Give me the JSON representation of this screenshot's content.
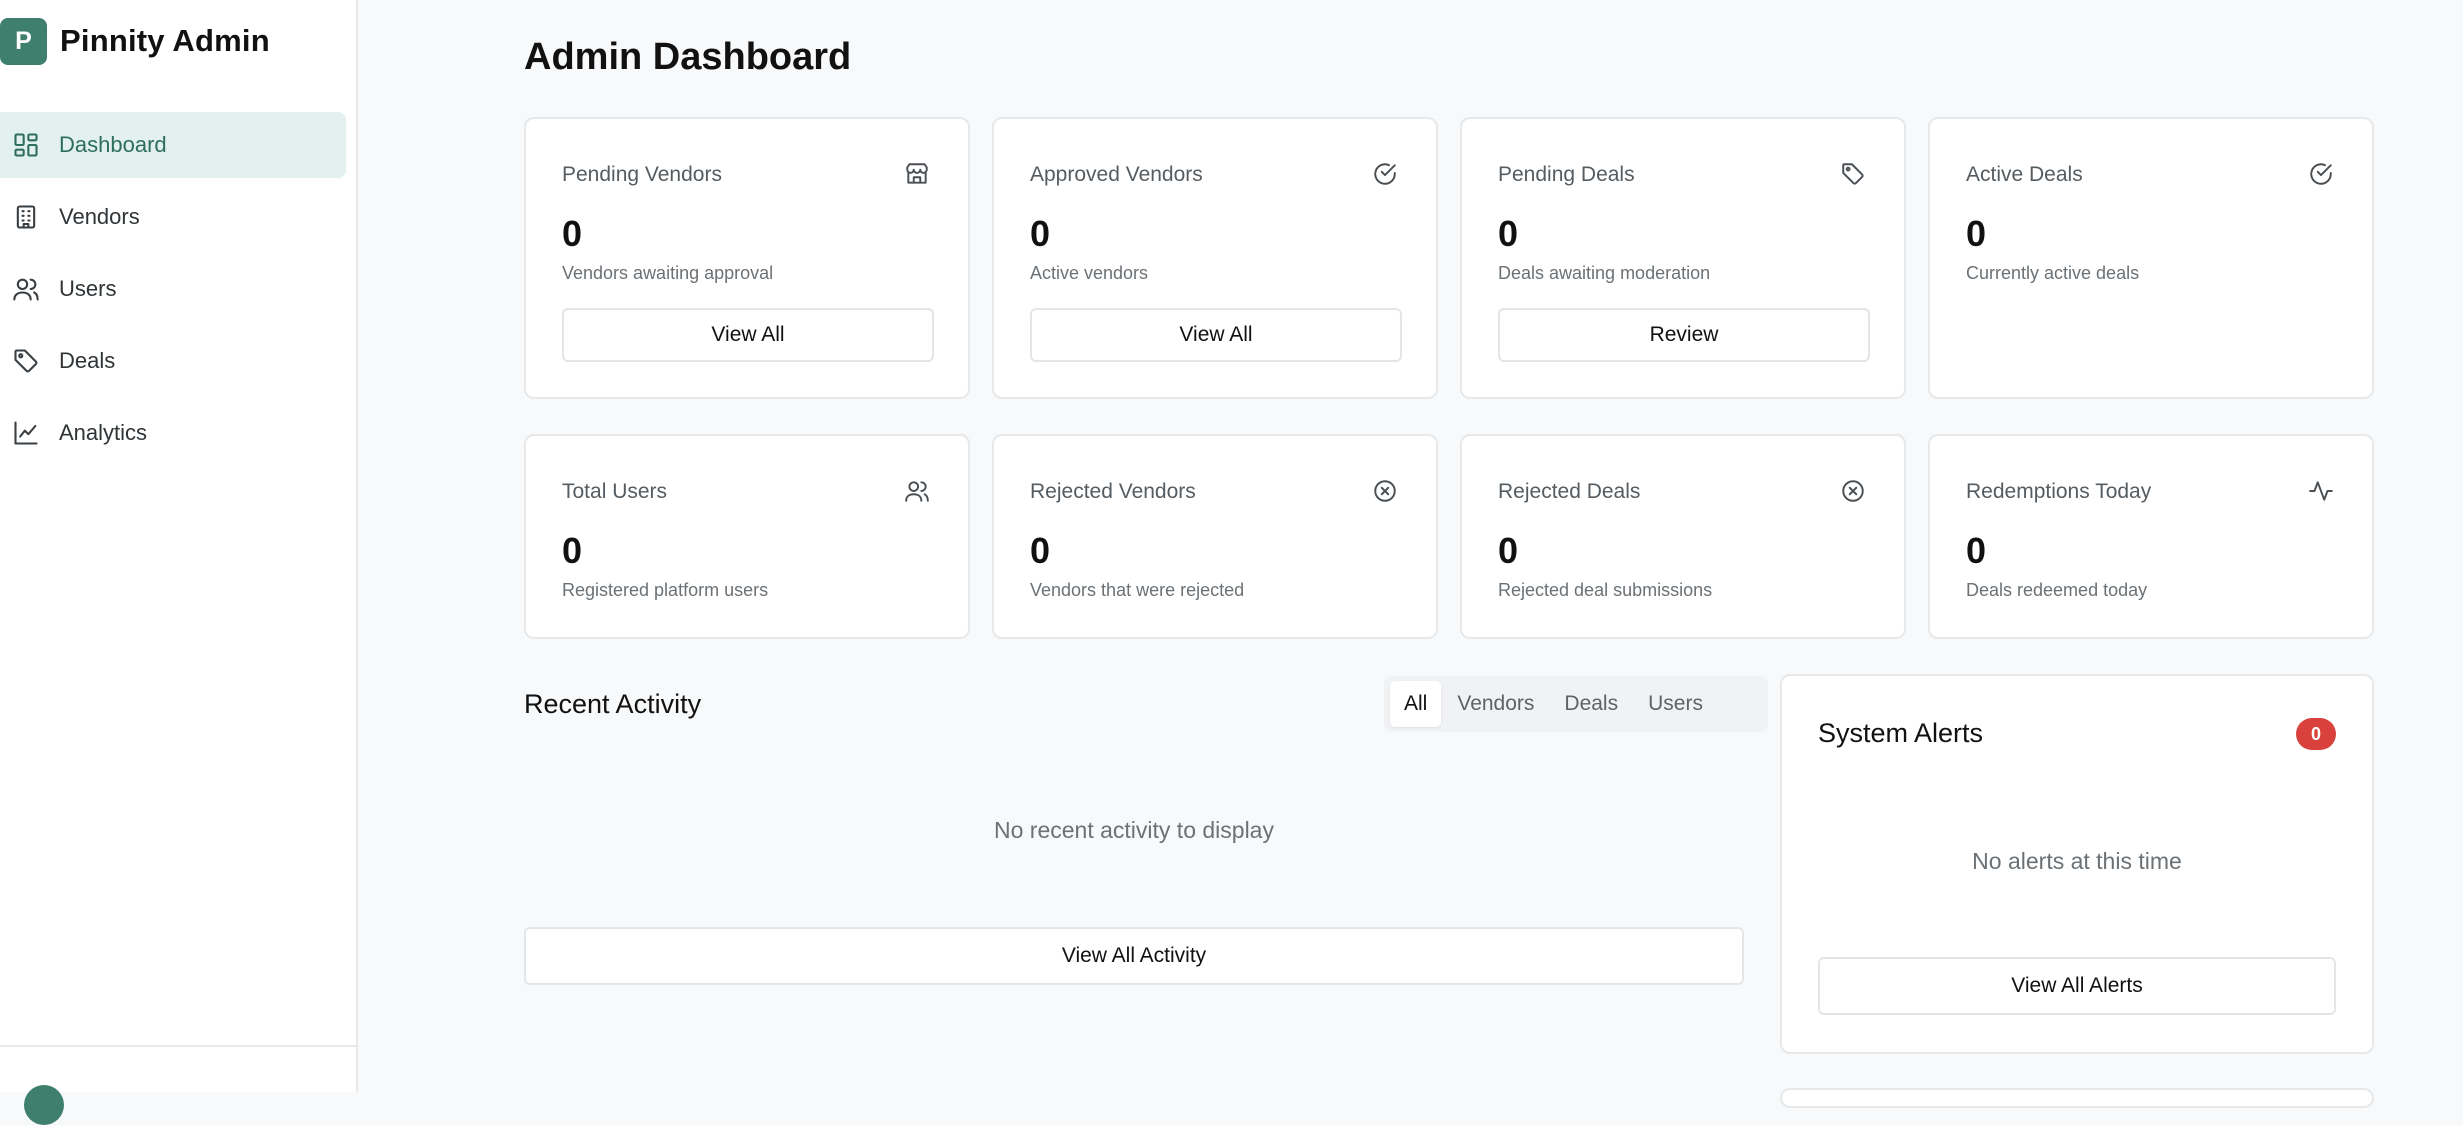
{
  "app": {
    "logo_letter": "P",
    "name": "Pinnity Admin"
  },
  "sidebar": {
    "items": [
      {
        "label": "Dashboard",
        "icon": "dashboard-grid-icon",
        "active": true
      },
      {
        "label": "Vendors",
        "icon": "building-icon"
      },
      {
        "label": "Users",
        "icon": "users-icon"
      },
      {
        "label": "Deals",
        "icon": "tag-icon"
      },
      {
        "label": "Analytics",
        "icon": "line-chart-icon"
      }
    ]
  },
  "page": {
    "title": "Admin Dashboard"
  },
  "stats": [
    {
      "title": "Pending Vendors",
      "value": "0",
      "subtitle": "Vendors awaiting approval",
      "button": "View All",
      "icon": "store-icon"
    },
    {
      "title": "Approved Vendors",
      "value": "0",
      "subtitle": "Active vendors",
      "button": "View All",
      "icon": "check-circle-icon"
    },
    {
      "title": "Pending Deals",
      "value": "0",
      "subtitle": "Deals awaiting moderation",
      "button": "Review",
      "icon": "tag-icon"
    },
    {
      "title": "Active Deals",
      "value": "0",
      "subtitle": "Currently active deals",
      "icon": "check-circle-icon"
    },
    {
      "title": "Total Users",
      "value": "0",
      "subtitle": "Registered platform users",
      "icon": "users-icon"
    },
    {
      "title": "Rejected Vendors",
      "value": "0",
      "subtitle": "Vendors that were rejected",
      "icon": "x-circle-icon"
    },
    {
      "title": "Rejected Deals",
      "value": "0",
      "subtitle": "Rejected deal submissions",
      "icon": "x-circle-icon"
    },
    {
      "title": "Redemptions Today",
      "value": "0",
      "subtitle": "Deals redeemed today",
      "icon": "activity-icon"
    }
  ],
  "recent_activity": {
    "title": "Recent Activity",
    "tabs": [
      "All",
      "Vendors",
      "Deals",
      "Users"
    ],
    "active_tab": "All",
    "empty_text": "No recent activity to display",
    "button": "View All Activity"
  },
  "system_alerts": {
    "title": "System Alerts",
    "count": "0",
    "empty_text": "No alerts at this time",
    "button": "View All Alerts"
  },
  "colors": {
    "brand": "#3f7f6d",
    "active_nav_bg": "#e2f0ee",
    "badge": "#d9413d"
  }
}
